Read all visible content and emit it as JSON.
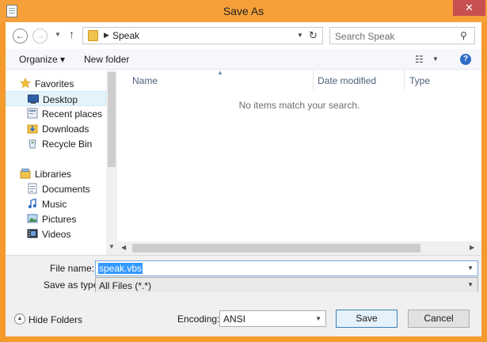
{
  "window": {
    "title": "Save As",
    "close_glyph": "✕"
  },
  "address": {
    "crumbs": [
      "Speak"
    ],
    "search_placeholder": "Search Speak"
  },
  "toolbar": {
    "organize": "Organize ▾",
    "new_folder": "New folder"
  },
  "nav": {
    "favorites": {
      "label": "Favorites",
      "items": [
        {
          "label": "Desktop",
          "icon": "desktop-icon",
          "selected": true
        },
        {
          "label": "Recent places",
          "icon": "recent-places-icon"
        },
        {
          "label": "Downloads",
          "icon": "downloads-icon"
        },
        {
          "label": "Recycle Bin",
          "icon": "recycle-bin-icon"
        }
      ]
    },
    "libraries": {
      "label": "Libraries",
      "items": [
        {
          "label": "Documents",
          "icon": "documents-icon"
        },
        {
          "label": "Music",
          "icon": "music-icon"
        },
        {
          "label": "Pictures",
          "icon": "pictures-icon"
        },
        {
          "label": "Videos",
          "icon": "videos-icon"
        }
      ]
    }
  },
  "filelist": {
    "columns": [
      "Name",
      "Date modified",
      "Type"
    ],
    "empty_message": "No items match your search."
  },
  "fields": {
    "file_name_label": "File name:",
    "file_name_value": "speak.vbs",
    "save_as_type_label": "Save as type:",
    "save_as_type_value": "All Files  (*.*)"
  },
  "footer": {
    "hide_folders": "Hide Folders",
    "encoding_label": "Encoding:",
    "encoding_value": "ANSI",
    "save": "Save",
    "cancel": "Cancel"
  }
}
